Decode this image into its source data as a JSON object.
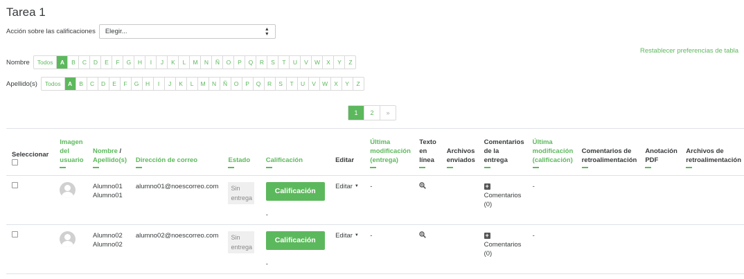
{
  "title": "Tarea 1",
  "action": {
    "label": "Acción sobre las calificaciones",
    "selected": "Elegir..."
  },
  "reset_link": "Restablecer preferencias de tabla",
  "first_name_filter": {
    "label": "Nombre",
    "todos": "Todos",
    "letters": [
      "A",
      "B",
      "C",
      "D",
      "E",
      "F",
      "G",
      "H",
      "I",
      "J",
      "K",
      "L",
      "M",
      "N",
      "Ñ",
      "O",
      "P",
      "Q",
      "R",
      "S",
      "T",
      "U",
      "V",
      "W",
      "X",
      "Y",
      "Z"
    ],
    "active": "A"
  },
  "last_name_filter": {
    "label": "Apellido(s)",
    "todos": "Todos",
    "letters": [
      "A",
      "B",
      "C",
      "D",
      "E",
      "F",
      "G",
      "H",
      "I",
      "J",
      "K",
      "L",
      "M",
      "N",
      "Ñ",
      "O",
      "P",
      "Q",
      "R",
      "S",
      "T",
      "U",
      "V",
      "W",
      "X",
      "Y",
      "Z"
    ],
    "active": "A"
  },
  "pagination": {
    "pages": [
      "1",
      "2"
    ],
    "next": "»",
    "active": "1"
  },
  "columns": {
    "select": "Seleccionar",
    "picture": [
      "Imagen",
      "del",
      "usuario"
    ],
    "name_a": "Nombre",
    "name_sep": " /",
    "name_b": "Apellido(s)",
    "email": "Dirección de correo",
    "status": "Estado",
    "grade": "Calificación",
    "edit": "Editar",
    "last_modified_submission": [
      "Última",
      "modificación",
      "(entrega)"
    ],
    "online_text": [
      "Texto",
      "en",
      "línea"
    ],
    "files": [
      "Archivos",
      "enviados"
    ],
    "submission_comments": [
      "Comentarios",
      "de la",
      "entrega"
    ],
    "last_modified_grade": [
      "Última",
      "modificación",
      "(calificación)"
    ],
    "feedback_comments": [
      "Comentarios de",
      "retroalimentación"
    ],
    "annotate_pdf": [
      "Anotación",
      "PDF"
    ],
    "feedback_files": [
      "Archivos de",
      "retroalimentación"
    ]
  },
  "rows": [
    {
      "first": "Alumno01",
      "last": "Alumno01",
      "email": "alumno01@noescorreo.com",
      "status": [
        "Sin",
        "entrega"
      ],
      "grade_button": "Calificación",
      "grade_value": "-",
      "edit": "Editar",
      "last_mod": "-",
      "comments": [
        "Comentarios",
        "(0)"
      ],
      "last_mod_grade": "-"
    },
    {
      "first": "Alumno02",
      "last": "Alumno02",
      "email": "alumno02@noescorreo.com",
      "status": [
        "Sin",
        "entrega"
      ],
      "grade_button": "Calificación",
      "grade_value": "-",
      "edit": "Editar",
      "last_mod": "-",
      "comments": [
        "Comentarios",
        "(0)"
      ],
      "last_mod_grade": "-"
    }
  ],
  "icons": {
    "select_caret": "up-down-caret-icon",
    "edit_caret": "caret-down-icon",
    "online_text": "magnifier-icon",
    "comments": "plus-box-icon",
    "avatar": "user-avatar-icon"
  },
  "colors": {
    "accent": "#5cb85c",
    "text": "#373a3c",
    "border": "#dee2e6"
  }
}
